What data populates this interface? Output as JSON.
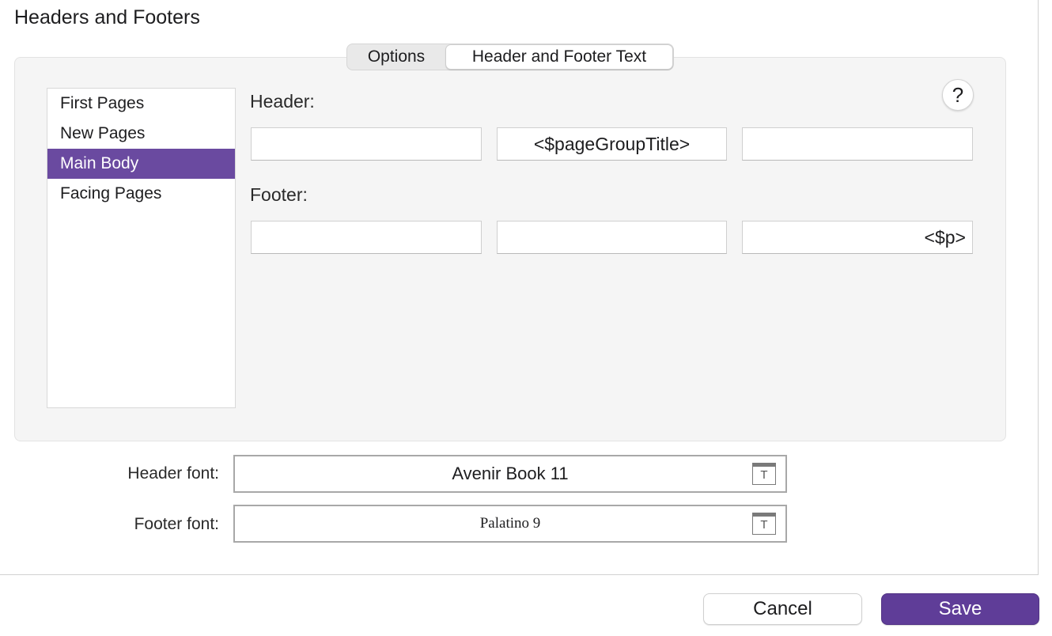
{
  "dialog": {
    "title": "Headers and Footers"
  },
  "tabs": [
    {
      "label": "Options",
      "selected": false
    },
    {
      "label": "Header and Footer Text",
      "selected": true
    }
  ],
  "page_list": {
    "items": [
      {
        "label": "First Pages",
        "selected": false
      },
      {
        "label": "New Pages",
        "selected": false
      },
      {
        "label": "Main Body",
        "selected": true
      },
      {
        "label": "Facing Pages",
        "selected": false
      }
    ]
  },
  "help_button": {
    "label": "?"
  },
  "header": {
    "label": "Header:",
    "left": "",
    "center": "<$pageGroupTitle>",
    "right": ""
  },
  "footer": {
    "label": "Footer:",
    "left": "",
    "center": "",
    "right": "<$p>"
  },
  "fonts": {
    "header_label": "Header font:",
    "header_value": "Avenir Book 11",
    "footer_label": "Footer font:",
    "footer_value": "Palatino 9",
    "icon_glyph": "T",
    "icon_name": "font-panel-icon"
  },
  "buttons": {
    "cancel": "Cancel",
    "save": "Save"
  },
  "colors": {
    "accent": "#6a4aa0",
    "save_button": "#5f3d98"
  }
}
